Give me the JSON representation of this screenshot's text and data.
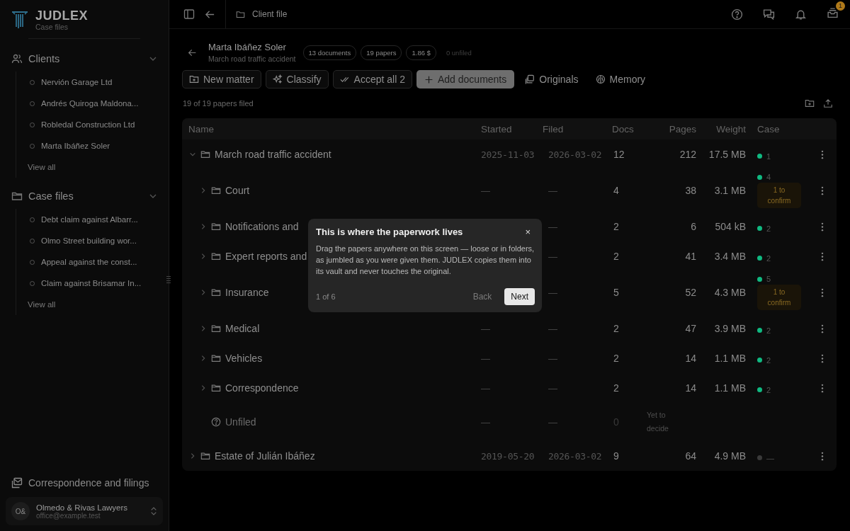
{
  "brand": {
    "name": "JUDLEX",
    "subtitle": "Case files"
  },
  "sidebar": {
    "sections": [
      {
        "title": "Clients",
        "expanded": true,
        "items": [
          "Nervión Garage Ltd",
          "Andrés Quiroga Maldona...",
          "Robledal Construction Ltd",
          "Marta Ibáñez Soler"
        ],
        "view_all": "View all"
      },
      {
        "title": "Case files",
        "expanded": true,
        "items": [
          "Debt claim against Albarr...",
          "Olmo Street building wor...",
          "Appeal against the const...",
          "Claim against Brisamar In..."
        ],
        "view_all": "View all"
      }
    ],
    "footer_link": "Correspondence and filings",
    "account": {
      "initials": "O&",
      "name": "Olmedo & Rivas Lawyers",
      "email": "office@example.test"
    }
  },
  "topbar": {
    "breadcrumb": "Client file",
    "inbox_badge": "1"
  },
  "header": {
    "client": "Marta Ibáñez Soler",
    "matter": "March road traffic accident",
    "chips": [
      {
        "label": "13 documents",
        "muted": false
      },
      {
        "label": "19 papers",
        "muted": false
      },
      {
        "label": "1.86 $",
        "muted": false
      },
      {
        "label": "0 unfiled",
        "muted": true
      }
    ]
  },
  "toolbar": [
    {
      "kind": "outline",
      "label": "New matter"
    },
    {
      "kind": "outline",
      "label": "Classify"
    },
    {
      "kind": "outline",
      "label": "Accept all 2"
    },
    {
      "kind": "primary",
      "label": "Add documents"
    },
    {
      "kind": "plain",
      "label": "Originals"
    },
    {
      "kind": "plain",
      "label": "Memory"
    }
  ],
  "filed_summary": "19 of 19 papers filed",
  "table": {
    "columns": [
      "Name",
      "Started",
      "Filed",
      "Docs",
      "Pages",
      "Weight",
      "Case"
    ],
    "rows": [
      {
        "kind": "folder",
        "name": "March road traffic accident",
        "expanded": true,
        "started": "2025-11-03",
        "filed": "2026-03-02",
        "docs": "12",
        "pages": "212",
        "weight": "17.5 MB",
        "case_count": "1",
        "color": "#10b981",
        "children": [
          {
            "kind": "folder",
            "name": "Court",
            "expanded": false,
            "started": "—",
            "filed": "—",
            "docs": "4",
            "pages": "38",
            "weight": "3.1 MB",
            "case_count": "4",
            "color": "#10b981",
            "pending": "1 to confirm"
          },
          {
            "kind": "folder",
            "name": "Notifications and",
            "expanded": false,
            "filed": "—",
            "docs": "2",
            "pages": "6",
            "weight": "504 kB",
            "case_count": "2",
            "color": "#10b981"
          },
          {
            "kind": "folder",
            "name": "Expert reports and",
            "expanded": false,
            "filed": "—",
            "docs": "2",
            "pages": "41",
            "weight": "3.4 MB",
            "case_count": "2",
            "color": "#10b981"
          },
          {
            "kind": "folder",
            "name": "Insurance",
            "expanded": false,
            "filed": "—",
            "docs": "5",
            "pages": "52",
            "weight": "4.3 MB",
            "case_count": "5",
            "color": "#10b981",
            "pending": "1 to confirm"
          },
          {
            "kind": "folder",
            "name": "Medical",
            "expanded": false,
            "started": "—",
            "filed": "—",
            "docs": "2",
            "pages": "47",
            "weight": "3.9 MB",
            "case_count": "2",
            "color": "#10b981"
          },
          {
            "kind": "folder",
            "name": "Vehicles",
            "expanded": false,
            "started": "—",
            "filed": "—",
            "docs": "2",
            "pages": "14",
            "weight": "1.1 MB",
            "case_count": "2",
            "color": "#10b981"
          },
          {
            "kind": "folder",
            "name": "Correspondence",
            "expanded": false,
            "started": "—",
            "filed": "—",
            "docs": "2",
            "pages": "14",
            "weight": "1.1 MB",
            "case_count": "2",
            "color": "#10b981"
          },
          {
            "kind": "unfiled",
            "name": "Unfiled",
            "started": "—",
            "filed": "—",
            "docs": "0",
            "pages": "Yet to decide"
          }
        ]
      },
      {
        "kind": "folder",
        "name": "Estate of Julián Ibáñez",
        "expanded": false,
        "started": "2019-05-20",
        "filed": "2026-03-02",
        "docs": "9",
        "pages": "64",
        "weight": "4.9 MB",
        "case_count": "—",
        "color": "#3a3a3a"
      }
    ]
  },
  "tour": {
    "title": "This is where the paperwork lives",
    "body": "Drag the papers anywhere on this screen — loose or in folders, as jumbled as you were given them. JUDLEX copies them into its vault and never touches the original.",
    "step": "1 of 6",
    "back": "Back",
    "next": "Next",
    "close": "×"
  }
}
